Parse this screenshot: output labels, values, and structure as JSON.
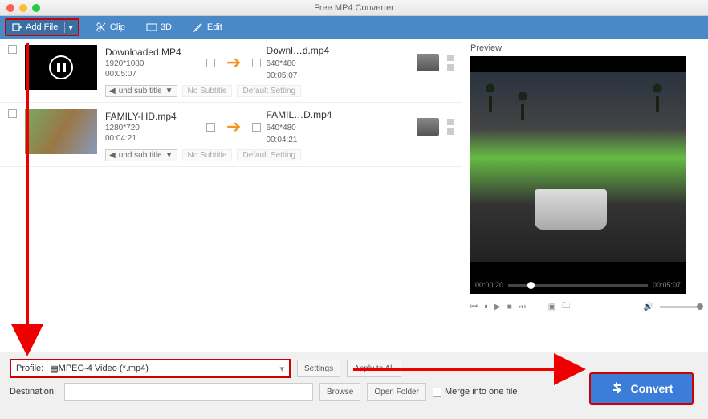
{
  "window": {
    "title": "Free MP4 Converter"
  },
  "toolbar": {
    "add_file": "Add File",
    "clip": "Clip",
    "threeD": "3D",
    "edit": "Edit"
  },
  "list": {
    "items": [
      {
        "in_name": "Downloaded MP4",
        "in_res": "1920*1080",
        "in_dur": "00:05:07",
        "out_name": "Downl…d.mp4",
        "out_res": "640*480",
        "out_dur": "00:05:07",
        "subtitle_dd": "und sub title",
        "placeholder1": "No Subtitle",
        "placeholder2": "Default Setting"
      },
      {
        "in_name": "FAMILY-HD.mp4",
        "in_res": "1280*720",
        "in_dur": "00:04:21",
        "out_name": "FAMIL…D.mp4",
        "out_res": "640*480",
        "out_dur": "00:04:21",
        "subtitle_dd": "und sub title",
        "placeholder1": "No Subtitle",
        "placeholder2": "Default Setting"
      }
    ]
  },
  "preview": {
    "label": "Preview",
    "time_current": "00:00:20",
    "time_total": "00:05:07"
  },
  "bottom": {
    "profile_label": "Profile:",
    "profile_value": "MPEG-4 Video (*.mp4)",
    "settings": "Settings",
    "apply": "Apply to All",
    "dest_label": "Destination:",
    "dest_value": "",
    "browse": "Browse",
    "open_folder": "Open Folder",
    "merge": "Merge into one file",
    "convert": "Convert"
  }
}
